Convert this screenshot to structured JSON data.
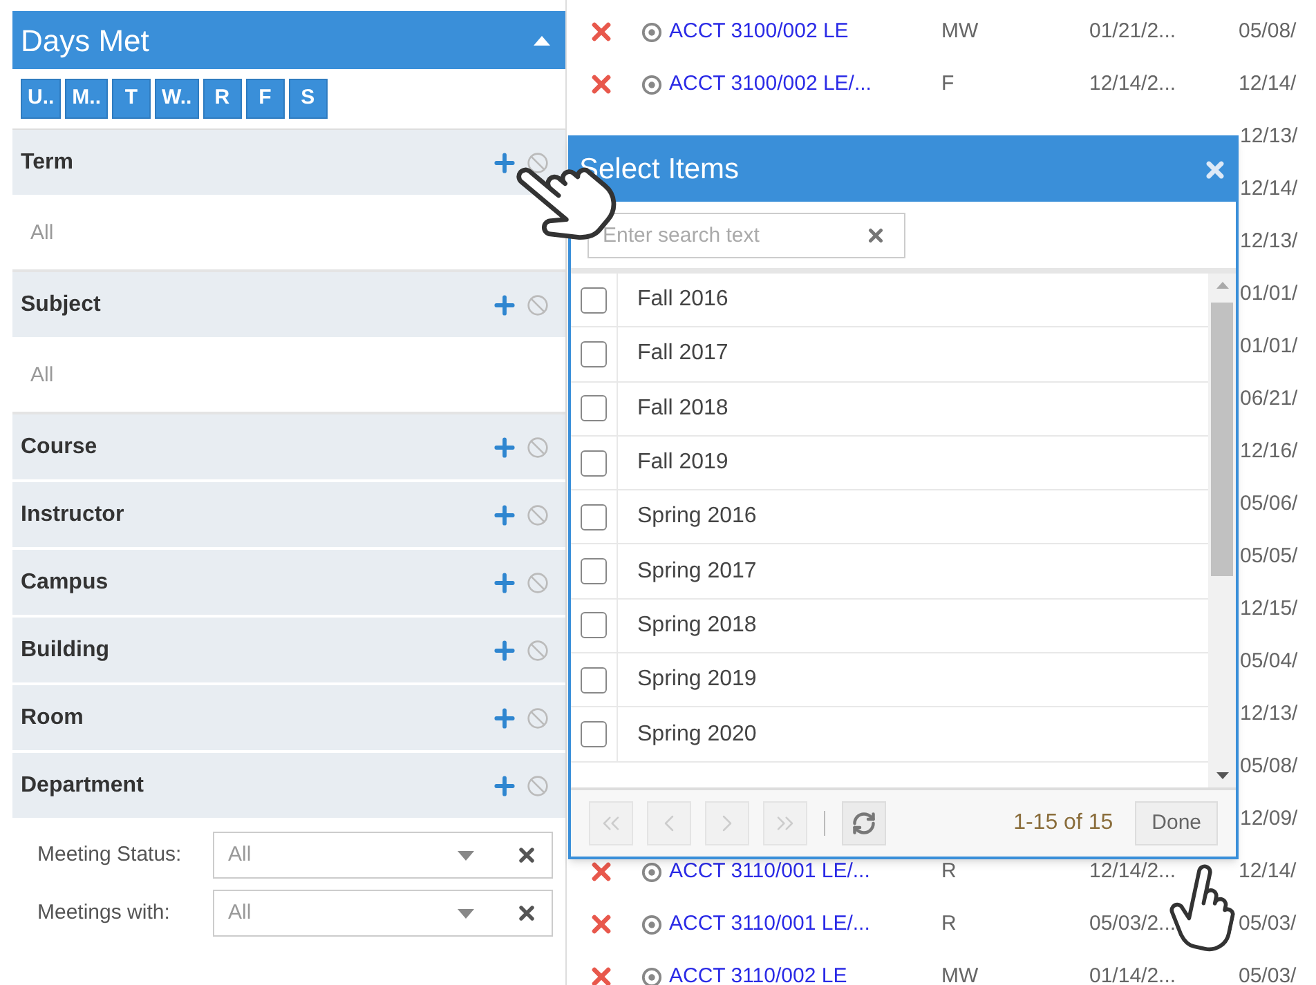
{
  "filters": {
    "title": "Days Met",
    "expanded": true,
    "days": [
      {
        "label": "U..",
        "selected": true
      },
      {
        "label": "M..",
        "selected": true
      },
      {
        "label": "T",
        "selected": true
      },
      {
        "label": "W..",
        "selected": true
      },
      {
        "label": "R",
        "selected": true
      },
      {
        "label": "F",
        "selected": true
      },
      {
        "label": "S",
        "selected": true
      }
    ],
    "sections": [
      {
        "label": "Term",
        "value": "All"
      },
      {
        "label": "Subject",
        "value": "All"
      },
      {
        "label": "Course"
      },
      {
        "label": "Instructor"
      },
      {
        "label": "Campus"
      },
      {
        "label": "Building"
      },
      {
        "label": "Room"
      },
      {
        "label": "Department"
      }
    ],
    "dropdowns": [
      {
        "label": "Meeting Status:",
        "value": "All"
      },
      {
        "label": "Meetings with:",
        "value": "All"
      }
    ]
  },
  "table": {
    "rows": [
      {
        "course": "ACCT 3100/002 LE",
        "days": "MW",
        "start": "01/21/2...",
        "end": "05/08/"
      },
      {
        "course": "ACCT 3100/002 LE/...",
        "days": "F",
        "start": "12/14/2...",
        "end": "12/14/"
      },
      {
        "end": "12/13/"
      },
      {
        "end": "12/14/"
      },
      {
        "end": "12/13/"
      },
      {
        "end": "01/01/"
      },
      {
        "end": "01/01/"
      },
      {
        "end": "06/21/"
      },
      {
        "end": "12/16/"
      },
      {
        "end": "05/06/"
      },
      {
        "end": "05/05/"
      },
      {
        "end": "12/15/"
      },
      {
        "end": "05/04/"
      },
      {
        "end": "12/13/"
      },
      {
        "end": "05/08/"
      },
      {
        "end": "12/09/"
      },
      {
        "course": "ACCT 3110/001 LE/...",
        "days": "R",
        "start": "12/14/2...",
        "end": "12/14/"
      },
      {
        "course": "ACCT 3110/001 LE/...",
        "days": "R",
        "start": "05/03/2...",
        "end": "05/03/"
      },
      {
        "course": "ACCT 3110/002 LE",
        "days": "MW",
        "start": "01/14/2...",
        "end": "05/03/"
      }
    ]
  },
  "dialog": {
    "title": "Select Items",
    "search": {
      "placeholder": "Enter search text"
    },
    "items": [
      {
        "label": "Fall 2016",
        "checked": false
      },
      {
        "label": "Fall 2017",
        "checked": false
      },
      {
        "label": "Fall 2018",
        "checked": false
      },
      {
        "label": "Fall 2019",
        "checked": false
      },
      {
        "label": "Spring 2016",
        "checked": false
      },
      {
        "label": "Spring 2017",
        "checked": false
      },
      {
        "label": "Spring 2018",
        "checked": false
      },
      {
        "label": "Spring 2019",
        "checked": false
      },
      {
        "label": "Spring 2020",
        "checked": false
      }
    ],
    "pager": {
      "range": "1-15 of 15"
    },
    "buttons": [
      "Done"
    ]
  }
}
